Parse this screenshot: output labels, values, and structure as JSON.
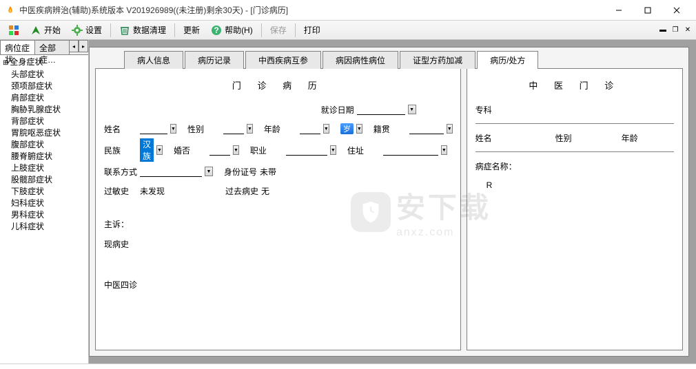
{
  "window": {
    "title": "中医疾病辨治(辅助)系统版本 V201926989((未注册)剩余30天) - [门诊病历]"
  },
  "toolbar": {
    "start": "开始",
    "settings": "设置",
    "cleanup": "数据清理",
    "update": "更新",
    "help": "帮助(H)",
    "save": "保存",
    "print": "打印"
  },
  "sidebar": {
    "tabs": {
      "loc": "病位症状",
      "all": "全部症…"
    },
    "root": "全身症状",
    "items": [
      "头部症状",
      "颈项部症状",
      "肩部症状",
      "胸胁乳腺症状",
      "背部症状",
      "胃脘呕恶症状",
      "腹部症状",
      "腰脊腑症状",
      "上肢症状",
      "股髋部症状",
      "下肢症状",
      "妇科症状",
      "男科症状",
      "儿科症状"
    ]
  },
  "doc_tabs": [
    "病人信息",
    "病历记录",
    "中西疾病互参",
    "病因病性病位",
    "证型方药加减",
    "病历/处方"
  ],
  "doc_tab_active": 5,
  "left_panel": {
    "title": "门 诊 病 历",
    "visit_date": "就诊日期",
    "name": "姓名",
    "sex": "性别",
    "age": "年龄",
    "age_unit": "岁",
    "native": "籍贯",
    "nation": "民族",
    "nation_val": "汉族",
    "marriage": "婚否",
    "occupation": "职业",
    "address": "住址",
    "contact": "联系方式",
    "idno": "身份证号",
    "idno_val": "未带",
    "allergy": "过敏史",
    "allergy_val": "未发现",
    "past": "过去病史",
    "past_val": "无",
    "chief": "主诉：",
    "hpi": "现病史",
    "tcm4": "中医四诊"
  },
  "right_panel": {
    "title": "中 医 门 诊",
    "dept": "专科",
    "name": "姓名",
    "sex": "性别",
    "age": "年龄",
    "disease": "病症名称：",
    "rx": "R"
  },
  "watermark": {
    "main": "安下载",
    "sub": "anxz.com"
  }
}
